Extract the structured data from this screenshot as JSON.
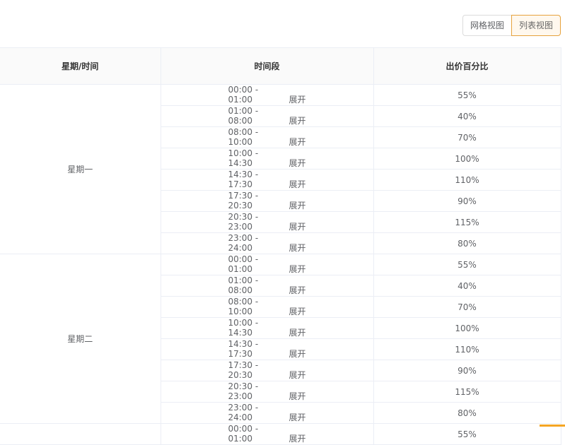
{
  "toolbar": {
    "grid_view_label": "网格视图",
    "list_view_label": "列表视图"
  },
  "table": {
    "headers": [
      "星期/时间",
      "时间段",
      "出价百分比"
    ],
    "expand_label": "展开",
    "days": [
      {
        "name": "星期一",
        "rows": [
          {
            "range": "00:00 - 01:00",
            "percent": "55%"
          },
          {
            "range": "01:00 - 08:00",
            "percent": "40%"
          },
          {
            "range": "08:00 - 10:00",
            "percent": "70%"
          },
          {
            "range": "10:00 - 14:30",
            "percent": "100%"
          },
          {
            "range": "14:30 - 17:30",
            "percent": "110%"
          },
          {
            "range": "17:30 - 20:30",
            "percent": "90%"
          },
          {
            "range": "20:30 - 23:00",
            "percent": "115%"
          },
          {
            "range": "23:00 - 24:00",
            "percent": "80%"
          }
        ]
      },
      {
        "name": "星期二",
        "rows": [
          {
            "range": "00:00 - 01:00",
            "percent": "55%"
          },
          {
            "range": "01:00 - 08:00",
            "percent": "40%"
          },
          {
            "range": "08:00 - 10:00",
            "percent": "70%"
          },
          {
            "range": "10:00 - 14:30",
            "percent": "100%"
          },
          {
            "range": "14:30 - 17:30",
            "percent": "110%"
          },
          {
            "range": "17:30 - 20:30",
            "percent": "90%"
          },
          {
            "range": "20:30 - 23:00",
            "percent": "115%"
          },
          {
            "range": "23:00 - 24:00",
            "percent": "80%"
          }
        ]
      },
      {
        "name": "",
        "rows": [
          {
            "range": "00:00 - 01:00",
            "percent": "55%"
          }
        ]
      }
    ]
  },
  "colors": {
    "accent": "#e6a23c",
    "border": "#ebeef5",
    "header_bg": "#fafafa"
  }
}
